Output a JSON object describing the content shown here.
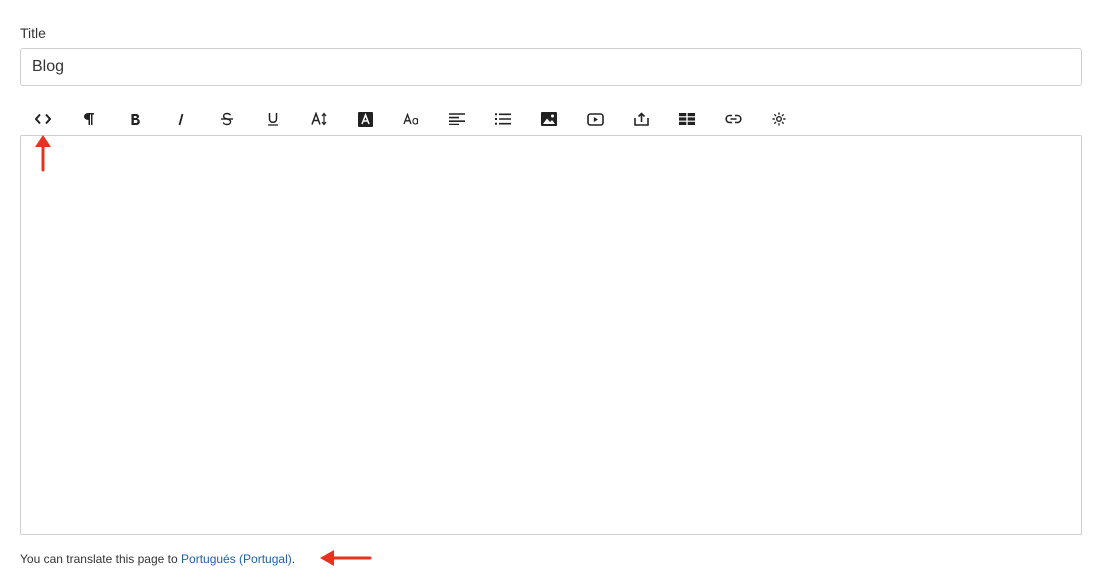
{
  "title_field": {
    "label": "Title",
    "value": "Blog"
  },
  "toolbar": {
    "buttons": [
      {
        "name": "code-view-button",
        "icon": "code-icon"
      },
      {
        "name": "paragraph-format-button",
        "icon": "pilcrow-icon"
      },
      {
        "name": "bold-button",
        "icon": "bold-icon"
      },
      {
        "name": "italic-button",
        "icon": "italic-icon"
      },
      {
        "name": "strikethrough-button",
        "icon": "strikethrough-icon"
      },
      {
        "name": "underline-button",
        "icon": "underline-icon"
      },
      {
        "name": "font-size-button",
        "icon": "font-size-icon"
      },
      {
        "name": "text-color-button",
        "icon": "text-color-icon"
      },
      {
        "name": "font-family-button",
        "icon": "font-family-icon"
      },
      {
        "name": "align-button",
        "icon": "align-left-icon"
      },
      {
        "name": "list-button",
        "icon": "bullet-list-icon"
      },
      {
        "name": "insert-image-button",
        "icon": "image-icon"
      },
      {
        "name": "insert-video-button",
        "icon": "video-icon"
      },
      {
        "name": "upload-file-button",
        "icon": "upload-icon"
      },
      {
        "name": "insert-table-button",
        "icon": "table-icon"
      },
      {
        "name": "insert-link-button",
        "icon": "link-icon"
      },
      {
        "name": "more-options-button",
        "icon": "gear-icon"
      }
    ]
  },
  "editor": {
    "content": ""
  },
  "translate_note": {
    "prefix": "You can translate this page to ",
    "link_text": "Portugués (Portugal)",
    "suffix": "."
  },
  "annotations": {
    "arrow_color": "#e8321e"
  }
}
